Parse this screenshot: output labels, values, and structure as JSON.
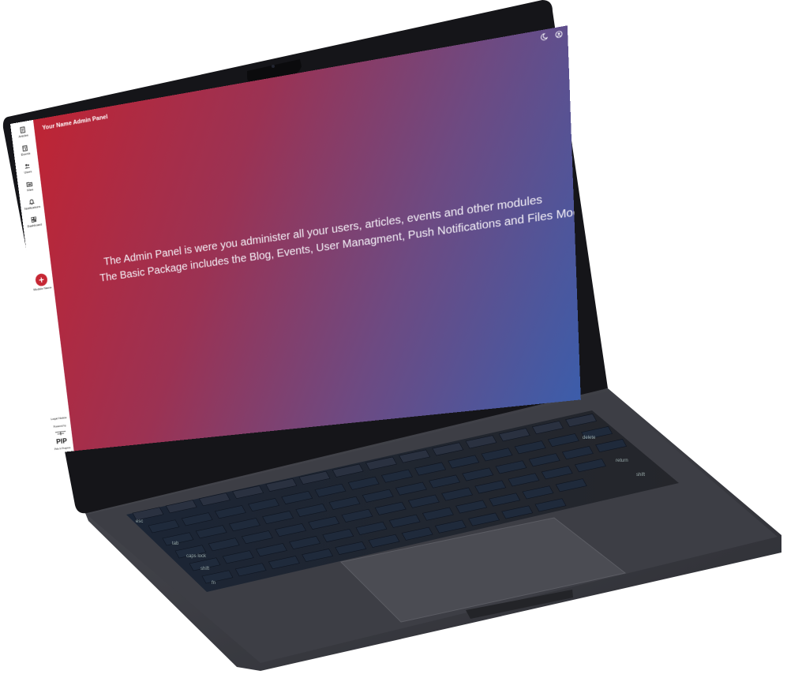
{
  "app": {
    "title": "Your Name Admin Panel"
  },
  "topbar": {
    "icons": [
      "moon-icon",
      "account-icon"
    ]
  },
  "sidebar": {
    "items": [
      {
        "label": "Articles",
        "icon": "article-icon"
      },
      {
        "label": "Events",
        "icon": "calendar-icon"
      },
      {
        "label": "Users",
        "icon": "users-icon"
      },
      {
        "label": "Files",
        "icon": "folder-icon"
      },
      {
        "label": "Notifications",
        "icon": "notification-icon"
      },
      {
        "label": "Dashboard",
        "icon": "dashboard-icon"
      }
    ],
    "add_module": {
      "label": "Module Name",
      "icon": "plus-icon"
    },
    "footer": {
      "legal_notice": "Legal Notice",
      "powered_by": "Powered by",
      "logo_text": "PIP",
      "logo_caption": "Pixls In Progress"
    }
  },
  "main": {
    "hero_lines": [
      "The Admin Panel is were you administer all your users, articles, events and other modules",
      "The Basic Package includes the Blog, Events, User Managment, Push Notifications and Files Module"
    ]
  },
  "keyboard": {
    "key_labels": [
      "esc",
      "tab",
      "caps lock",
      "shift",
      "delete",
      "return",
      "shift",
      "fn"
    ]
  },
  "colors": {
    "gradient_start": "#c22331",
    "gradient_end": "#3c5daa",
    "accent": "#c62734",
    "laptop_body": "#3c3d44"
  }
}
